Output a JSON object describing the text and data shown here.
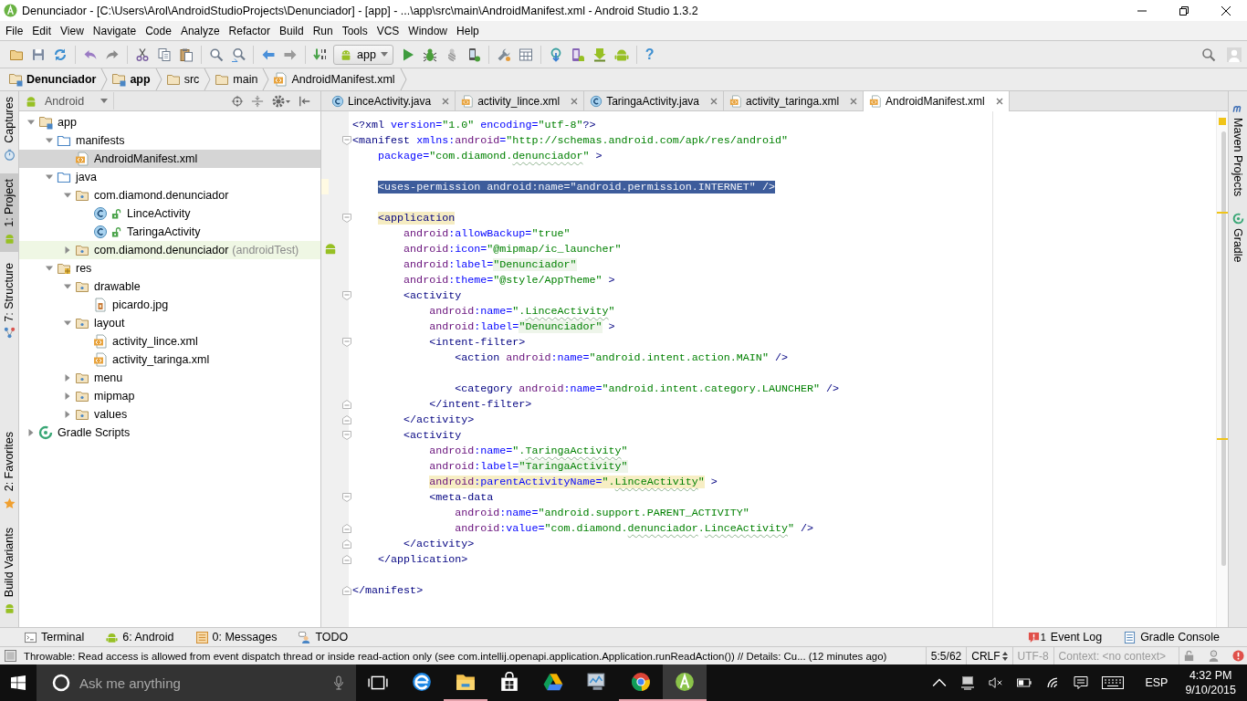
{
  "window": {
    "title": "Denunciador - [C:\\Users\\Arol\\AndroidStudioProjects\\Denunciador] - [app] - ...\\app\\src\\main\\AndroidManifest.xml - Android Studio 1.3.2"
  },
  "menu": [
    "File",
    "Edit",
    "View",
    "Navigate",
    "Code",
    "Analyze",
    "Refactor",
    "Build",
    "Run",
    "Tools",
    "VCS",
    "Window",
    "Help"
  ],
  "toolbar": {
    "run_configuration": "app",
    "help": "?"
  },
  "breadcrumbs": [
    {
      "label": "Denunciador",
      "kind": "project"
    },
    {
      "label": "app",
      "kind": "module"
    },
    {
      "label": "src",
      "kind": "folder"
    },
    {
      "label": "main",
      "kind": "folder"
    },
    {
      "label": "AndroidManifest.xml",
      "kind": "xml"
    }
  ],
  "left_tool_strip": {
    "top": [
      {
        "label": "Captures",
        "selected": false
      },
      {
        "label": "1: Project",
        "selected": true
      },
      {
        "label": "7: Structure",
        "selected": false
      }
    ],
    "bottom": [
      {
        "label": "2: Favorites",
        "selected": false
      },
      {
        "label": "Build Variants",
        "selected": false
      }
    ]
  },
  "project_panel": {
    "view": "Android",
    "tree": [
      {
        "label": "app",
        "kind": "module",
        "expanded": true,
        "selected": false,
        "children": [
          {
            "label": "manifests",
            "kind": "source-folder",
            "expanded": true,
            "selected": false,
            "children": [
              {
                "label": "AndroidManifest.xml",
                "kind": "xml",
                "selected": true
              }
            ]
          },
          {
            "label": "java",
            "kind": "source-folder",
            "expanded": true,
            "selected": false,
            "children": [
              {
                "label": "com.diamond.denunciador",
                "kind": "package",
                "expanded": true,
                "selected": false,
                "children": [
                  {
                    "label": "LinceActivity",
                    "kind": "class",
                    "selected": false
                  },
                  {
                    "label": "TaringaActivity",
                    "kind": "class",
                    "selected": false
                  }
                ]
              },
              {
                "label": "com.diamond.denunciador",
                "note": "(androidTest)",
                "kind": "test-package",
                "expanded": false,
                "selected": false
              }
            ]
          },
          {
            "label": "res",
            "kind": "res-folder",
            "expanded": true,
            "selected": false,
            "children": [
              {
                "label": "drawable",
                "kind": "package",
                "expanded": true,
                "selected": false,
                "children": [
                  {
                    "label": "picardo.jpg",
                    "kind": "image",
                    "selected": false
                  }
                ]
              },
              {
                "label": "layout",
                "kind": "package",
                "expanded": true,
                "selected": false,
                "children": [
                  {
                    "label": "activity_lince.xml",
                    "kind": "xml",
                    "selected": false
                  },
                  {
                    "label": "activity_taringa.xml",
                    "kind": "xml",
                    "selected": false
                  }
                ]
              },
              {
                "label": "menu",
                "kind": "package",
                "expanded": false,
                "selected": false
              },
              {
                "label": "mipmap",
                "kind": "package",
                "expanded": false,
                "selected": false
              },
              {
                "label": "values",
                "kind": "package",
                "expanded": false,
                "selected": false
              }
            ]
          }
        ]
      },
      {
        "label": "Gradle Scripts",
        "kind": "gradle",
        "expanded": false,
        "selected": false
      }
    ]
  },
  "editor": {
    "tabs": [
      {
        "label": "LinceActivity.java",
        "kind": "class",
        "selected": false
      },
      {
        "label": "activity_lince.xml",
        "kind": "xml",
        "selected": false
      },
      {
        "label": "TaringaActivity.java",
        "kind": "class",
        "selected": false
      },
      {
        "label": "activity_taringa.xml",
        "kind": "xml",
        "selected": false
      },
      {
        "label": "AndroidManifest.xml",
        "kind": "xml",
        "selected": true
      }
    ],
    "lines": [
      {
        "kind": "line",
        "selected": false,
        "caret": false,
        "tokens": [
          {
            "text": "<?xml",
            "kind": "tag"
          },
          {
            "text": " version=",
            "kind": "attr"
          },
          {
            "text": "\"1.0\"",
            "kind": "value"
          },
          {
            "text": " encoding=",
            "kind": "attr"
          },
          {
            "text": "\"utf-8\"",
            "kind": "value"
          },
          {
            "text": "?>",
            "kind": "tag"
          }
        ]
      },
      {
        "kind": "fold-start",
        "selected": false,
        "caret": false,
        "tokens": [
          {
            "text": "<manifest",
            "kind": "tag"
          },
          {
            "text": " xmlns:",
            "kind": "attr"
          },
          {
            "text": "android",
            "kind": "ns"
          },
          {
            "text": "=",
            "kind": "attr"
          },
          {
            "text": "\"http://schemas.android.com/apk/res/android\"",
            "kind": "value"
          }
        ],
        "children": [
          {
            "kind": "line",
            "selected": false,
            "caret": false,
            "tokens": [
              {
                "text": "package=",
                "kind": "attr"
              },
              {
                "text": "\"com.diamond.",
                "kind": "value"
              },
              {
                "text": "denunciador",
                "kind": "value-typo"
              },
              {
                "text": "\"",
                "kind": "value"
              },
              {
                "text": " >",
                "kind": "tag"
              }
            ]
          },
          {
            "kind": "blank"
          },
          {
            "kind": "line",
            "selected": true,
            "caret": true,
            "tokens": [
              {
                "text": "<uses-permission",
                "kind": "tag"
              },
              {
                "text": " android",
                "kind": "ns"
              },
              {
                "text": ":name=",
                "kind": "attr"
              },
              {
                "text": "\"android.permission.INTERNET\"",
                "kind": "value"
              },
              {
                "text": " />",
                "kind": "tag"
              }
            ]
          },
          {
            "kind": "blank"
          },
          {
            "kind": "fold-start",
            "selected": false,
            "caret": false,
            "tokens": [
              {
                "text": "<application",
                "kind": "tag-match"
              }
            ],
            "children": [
              {
                "kind": "line",
                "selected": false,
                "caret": false,
                "tokens": [
                  {
                    "text": "android",
                    "kind": "ns"
                  },
                  {
                    "text": ":allowBackup=",
                    "kind": "attr"
                  },
                  {
                    "text": "\"true\"",
                    "kind": "value"
                  }
                ]
              },
              {
                "kind": "line",
                "selected": false,
                "caret": false,
                "gutter_marker": true,
                "tokens": [
                  {
                    "text": "android",
                    "kind": "ns"
                  },
                  {
                    "text": ":icon=",
                    "kind": "attr"
                  },
                  {
                    "text": "\"@mipmap/ic_launcher\"",
                    "kind": "value"
                  }
                ]
              },
              {
                "kind": "line",
                "selected": false,
                "caret": false,
                "tokens": [
                  {
                    "text": "android",
                    "kind": "ns"
                  },
                  {
                    "text": ":label=",
                    "kind": "attr"
                  },
                  {
                    "text": "\"Denunciador\"",
                    "kind": "value-hardcoded"
                  }
                ]
              },
              {
                "kind": "line",
                "selected": false,
                "caret": false,
                "tokens": [
                  {
                    "text": "android",
                    "kind": "ns"
                  },
                  {
                    "text": ":theme=",
                    "kind": "attr"
                  },
                  {
                    "text": "\"@style/AppTheme\"",
                    "kind": "value"
                  },
                  {
                    "text": " >",
                    "kind": "tag"
                  }
                ]
              },
              {
                "kind": "fold-start",
                "selected": false,
                "caret": false,
                "tokens": [
                  {
                    "text": "<activity",
                    "kind": "tag"
                  }
                ],
                "children": [
                  {
                    "kind": "line",
                    "selected": false,
                    "caret": false,
                    "tokens": [
                      {
                        "text": "android",
                        "kind": "ns"
                      },
                      {
                        "text": ":name=",
                        "kind": "attr"
                      },
                      {
                        "text": "\".",
                        "kind": "value"
                      },
                      {
                        "text": "LinceActivity",
                        "kind": "value-typo"
                      },
                      {
                        "text": "\"",
                        "kind": "value"
                      }
                    ]
                  },
                  {
                    "kind": "line",
                    "selected": false,
                    "caret": false,
                    "tokens": [
                      {
                        "text": "android",
                        "kind": "ns"
                      },
                      {
                        "text": ":label=",
                        "kind": "attr"
                      },
                      {
                        "text": "\"Denunciador\"",
                        "kind": "value-hardcoded"
                      },
                      {
                        "text": " >",
                        "kind": "tag"
                      }
                    ]
                  },
                  {
                    "kind": "fold-start",
                    "selected": false,
                    "caret": false,
                    "tokens": [
                      {
                        "text": "<intent-filter>",
                        "kind": "tag"
                      }
                    ],
                    "children": [
                      {
                        "kind": "line",
                        "selected": false,
                        "caret": false,
                        "tokens": [
                          {
                            "text": "<action",
                            "kind": "tag"
                          },
                          {
                            "text": " android",
                            "kind": "ns"
                          },
                          {
                            "text": ":name=",
                            "kind": "attr"
                          },
                          {
                            "text": "\"android.intent.action.MAIN\"",
                            "kind": "value"
                          },
                          {
                            "text": " />",
                            "kind": "tag"
                          }
                        ]
                      },
                      {
                        "kind": "blank"
                      },
                      {
                        "kind": "line",
                        "selected": false,
                        "caret": false,
                        "tokens": [
                          {
                            "text": "<category",
                            "kind": "tag"
                          },
                          {
                            "text": " android",
                            "kind": "ns"
                          },
                          {
                            "text": ":name=",
                            "kind": "attr"
                          },
                          {
                            "text": "\"android.intent.category.LAUNCHER\"",
                            "kind": "value"
                          },
                          {
                            "text": " />",
                            "kind": "tag"
                          }
                        ]
                      }
                    ]
                  },
                  {
                    "kind": "fold-end",
                    "selected": false,
                    "caret": false,
                    "tokens": [
                      {
                        "text": "</intent-filter>",
                        "kind": "tag"
                      }
                    ]
                  }
                ]
              },
              {
                "kind": "fold-end",
                "selected": false,
                "caret": false,
                "tokens": [
                  {
                    "text": "</activity>",
                    "kind": "tag"
                  }
                ]
              },
              {
                "kind": "fold-start",
                "selected": false,
                "caret": false,
                "tokens": [
                  {
                    "text": "<activity",
                    "kind": "tag"
                  }
                ],
                "children": [
                  {
                    "kind": "line",
                    "selected": false,
                    "caret": false,
                    "tokens": [
                      {
                        "text": "android",
                        "kind": "ns"
                      },
                      {
                        "text": ":name=",
                        "kind": "attr"
                      },
                      {
                        "text": "\".",
                        "kind": "value"
                      },
                      {
                        "text": "TaringaActivity",
                        "kind": "value-typo"
                      },
                      {
                        "text": "\"",
                        "kind": "value"
                      }
                    ]
                  },
                  {
                    "kind": "line",
                    "selected": false,
                    "caret": false,
                    "tokens": [
                      {
                        "text": "android",
                        "kind": "ns"
                      },
                      {
                        "text": ":label=",
                        "kind": "attr"
                      },
                      {
                        "text": "\"TaringaActivity\"",
                        "kind": "value-hardcoded"
                      }
                    ]
                  },
                  {
                    "kind": "line",
                    "selected": false,
                    "caret": false,
                    "tokens": [
                      {
                        "text": "android",
                        "kind": "ns-warning"
                      },
                      {
                        "text": ":parentActivityName=",
                        "kind": "attr-warning"
                      },
                      {
                        "text": "\".",
                        "kind": "value-warning"
                      },
                      {
                        "text": "LinceActivity",
                        "kind": "value-warning-typo"
                      },
                      {
                        "text": "\"",
                        "kind": "value-warning"
                      },
                      {
                        "text": " >",
                        "kind": "tag"
                      }
                    ]
                  },
                  {
                    "kind": "fold-start",
                    "selected": false,
                    "caret": false,
                    "tokens": [
                      {
                        "text": "<meta-data",
                        "kind": "tag"
                      }
                    ],
                    "children": [
                      {
                        "kind": "line",
                        "selected": false,
                        "caret": false,
                        "tokens": [
                          {
                            "text": "android",
                            "kind": "ns"
                          },
                          {
                            "text": ":name=",
                            "kind": "attr"
                          },
                          {
                            "text": "\"android.support.PARENT_ACTIVITY\"",
                            "kind": "value"
                          }
                        ]
                      },
                      {
                        "kind": "fold-end",
                        "selected": false,
                        "caret": false,
                        "tokens": [
                          {
                            "text": "android",
                            "kind": "ns"
                          },
                          {
                            "text": ":value=",
                            "kind": "attr"
                          },
                          {
                            "text": "\"com.diamond.",
                            "kind": "value"
                          },
                          {
                            "text": "denunciador",
                            "kind": "value-typo"
                          },
                          {
                            "text": ".",
                            "kind": "value"
                          },
                          {
                            "text": "LinceActivity",
                            "kind": "value-typo"
                          },
                          {
                            "text": "\"",
                            "kind": "value"
                          },
                          {
                            "text": " />",
                            "kind": "tag"
                          }
                        ]
                      }
                    ]
                  }
                ]
              },
              {
                "kind": "fold-end",
                "selected": false,
                "caret": false,
                "tokens": [
                  {
                    "text": "</activity>",
                    "kind": "tag"
                  }
                ]
              }
            ]
          },
          {
            "kind": "fold-end",
            "selected": false,
            "caret": false,
            "tokens": [
              {
                "text": "</application>",
                "kind": "tag"
              }
            ]
          }
        ]
      },
      {
        "kind": "blank"
      },
      {
        "kind": "fold-end",
        "selected": false,
        "caret": false,
        "tokens": [
          {
            "text": "</manifest>",
            "kind": "tag"
          }
        ]
      }
    ]
  },
  "right_tool_strip": [
    {
      "label": "Maven Projects",
      "selected": false
    },
    {
      "label": "Gradle",
      "selected": false
    }
  ],
  "bottom_tool_bar": {
    "left": [
      {
        "label": "Terminal",
        "selected": false
      },
      {
        "label": "6: Android",
        "selected": false
      },
      {
        "label": "0: Messages",
        "selected": false
      },
      {
        "label": "TODO",
        "selected": false
      }
    ],
    "right": [
      {
        "label": "Event Log",
        "badge": "1",
        "selected": false
      },
      {
        "label": "Gradle Console",
        "selected": false
      }
    ]
  },
  "status_bar": {
    "message": "Throwable: Read access is allowed from event dispatch thread or inside read-action only (see com.intellij.openapi.application.Application.runReadAction()) // Details: Cu... (12 minutes ago)",
    "position": "5:5/62",
    "line_separator": "CRLF",
    "encoding": {
      "text": "UTF-8",
      "disabled": true
    },
    "context": {
      "text": "Context: <no context>",
      "disabled": true
    }
  },
  "taskbar": {
    "search": {
      "placeholder": "Ask me anything"
    },
    "apps": [
      {
        "running": false,
        "selected": false
      },
      {
        "running": true,
        "selected": false
      },
      {
        "running": false,
        "selected": false
      },
      {
        "running": false,
        "selected": false
      },
      {
        "running": false,
        "selected": false
      },
      {
        "running": true,
        "selected": false
      },
      {
        "running": true,
        "selected": true
      }
    ],
    "language": "ESP",
    "time": "4:32 PM",
    "date": "9/10/2015"
  }
}
